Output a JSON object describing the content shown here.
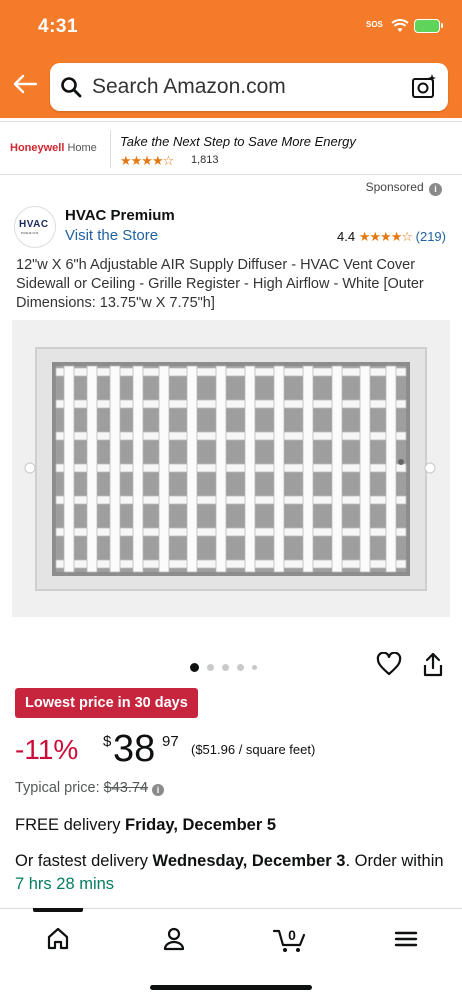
{
  "status_bar": {
    "time": "4:31",
    "sos": "SOS"
  },
  "search": {
    "placeholder": "Search Amazon.com"
  },
  "banner": {
    "brand_primary": "Honeywell",
    "brand_secondary": " Home",
    "tagline": "Take the Next Step to Save More Energy",
    "stars": "★★★★☆",
    "review_count": "1,813"
  },
  "sponsored_label": "Sponsored",
  "brand": {
    "logo_text": "HVAC",
    "logo_subtext": "PREMIUM",
    "name": "HVAC Premium",
    "store_link": "Visit the Store",
    "rating": "4.4",
    "stars": "★★★★☆",
    "rating_count": "(219)"
  },
  "product": {
    "title": "12\"w X 6\"h Adjustable AIR Supply Diffuser - HVAC Vent Cover Sidewall or Ceiling - Grille Register - High Airflow - White [Outer Dimensions: 13.75\"w X 7.75\"h]"
  },
  "carousel": {
    "active_index": 0,
    "count": 5
  },
  "deal_badge": "Lowest price in 30 days",
  "price": {
    "discount": "-11%",
    "currency": "$",
    "whole": "38",
    "fraction": "97",
    "unit": "($51.96 / square feet)"
  },
  "typical": {
    "label": "Typical price: ",
    "value": "$43.74"
  },
  "delivery": {
    "prefix": "FREE delivery ",
    "date": "Friday, December 5"
  },
  "fastest": {
    "prefix": "Or fastest delivery ",
    "date": "Wednesday, December 3",
    "middle": ". Order within ",
    "countdown": "7 hrs 28 mins"
  },
  "cart_count": "0",
  "colors": {
    "header": "#f47b29",
    "deal_badge": "#c7253e",
    "discount": "#cc0c39",
    "link": "#2162a1",
    "star": "#e47911",
    "countdown": "#067d62"
  }
}
